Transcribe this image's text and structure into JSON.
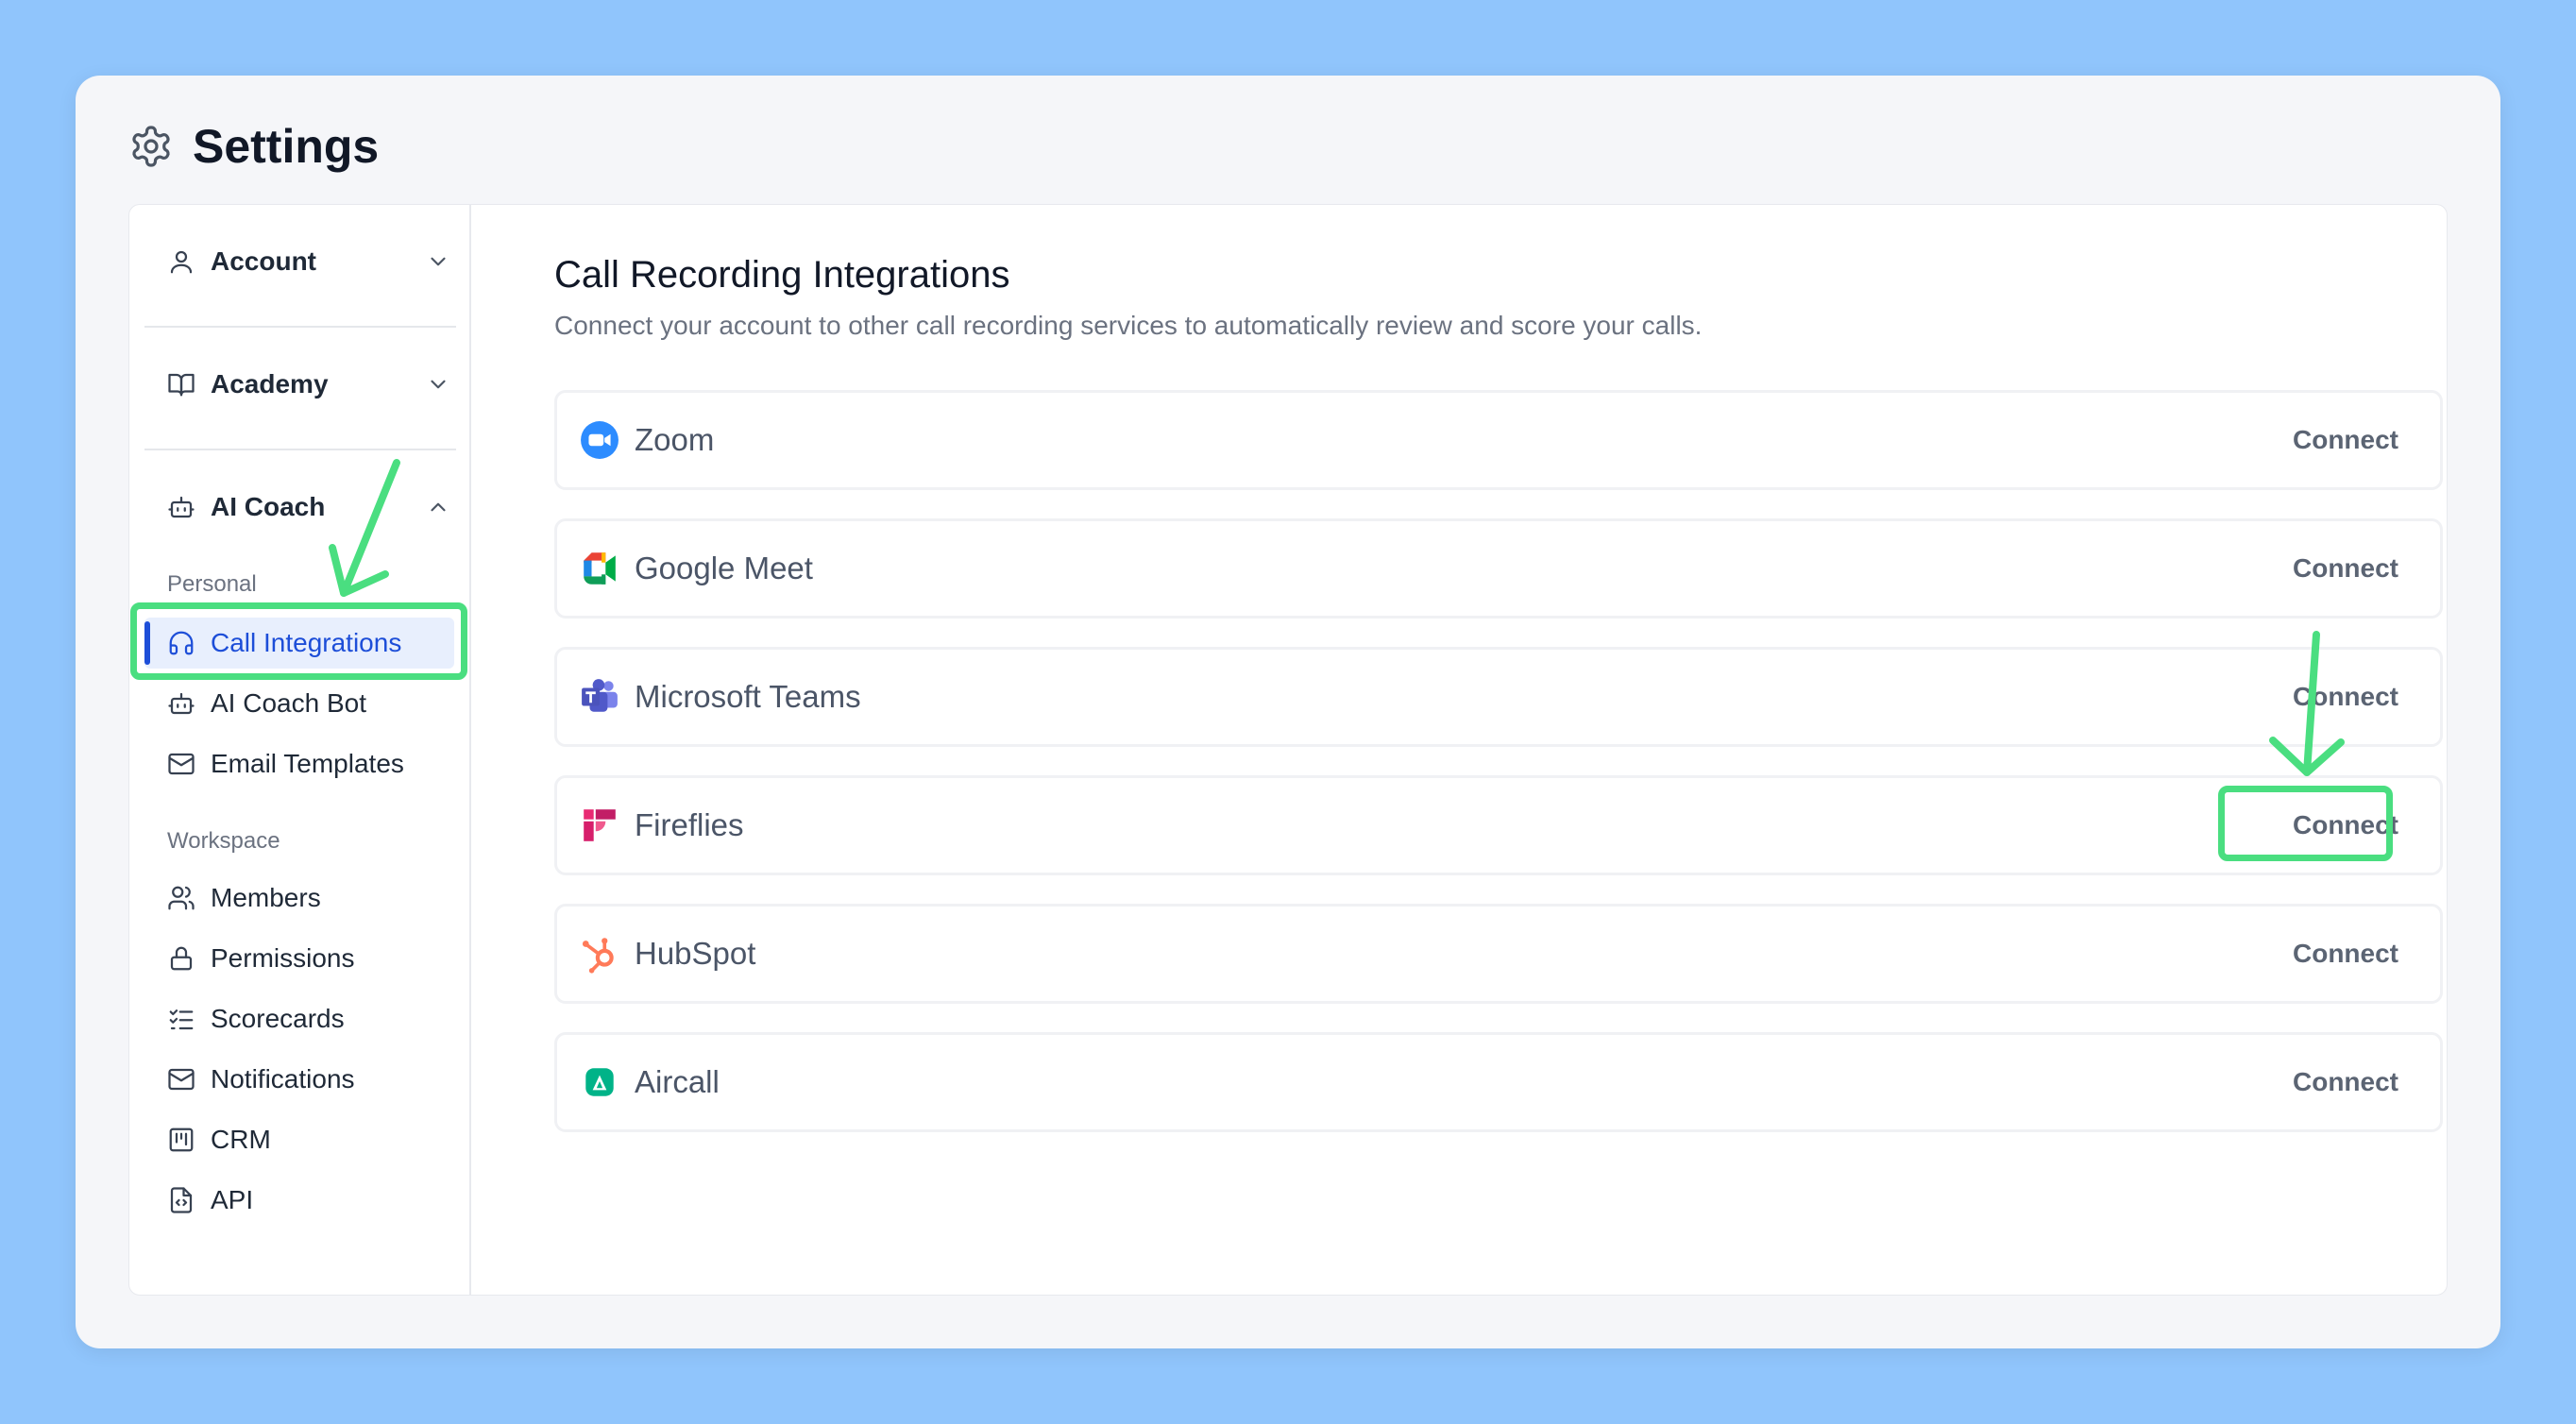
{
  "page": {
    "title": "Settings",
    "icon": "gear-icon"
  },
  "sidebar": {
    "sections": [
      {
        "label": "Account",
        "icon": "user-icon",
        "expanded": false
      },
      {
        "label": "Academy",
        "icon": "book-icon",
        "expanded": false
      },
      {
        "label": "AI Coach",
        "icon": "bot-icon",
        "expanded": true
      }
    ],
    "groups": {
      "personal": "Personal",
      "workspace": "Workspace"
    },
    "personal_items": [
      {
        "label": "Call Integrations",
        "icon": "headset-icon",
        "active": true
      },
      {
        "label": "AI Coach Bot",
        "icon": "bot-icon"
      },
      {
        "label": "Email Templates",
        "icon": "mail-icon"
      }
    ],
    "workspace_items": [
      {
        "label": "Members",
        "icon": "users-icon"
      },
      {
        "label": "Permissions",
        "icon": "lock-icon"
      },
      {
        "label": "Scorecards",
        "icon": "checklist-icon"
      },
      {
        "label": "Notifications",
        "icon": "mail-icon"
      },
      {
        "label": "CRM",
        "icon": "kanban-icon"
      },
      {
        "label": "API",
        "icon": "file-code-icon"
      }
    ]
  },
  "main": {
    "title": "Call Recording Integrations",
    "description": "Connect your account to other call recording services to automatically review and score your calls.",
    "integrations": [
      {
        "name": "Zoom",
        "icon": "zoom-logo-icon",
        "action": "Connect"
      },
      {
        "name": "Google Meet",
        "icon": "google-meet-logo-icon",
        "action": "Connect"
      },
      {
        "name": "Microsoft Teams",
        "icon": "microsoft-teams-logo-icon",
        "action": "Connect"
      },
      {
        "name": "Fireflies",
        "icon": "fireflies-logo-icon",
        "action": "Connect"
      },
      {
        "name": "HubSpot",
        "icon": "hubspot-logo-icon",
        "action": "Connect"
      },
      {
        "name": "Aircall",
        "icon": "aircall-logo-icon",
        "action": "Connect"
      }
    ]
  },
  "annotations": {
    "highlight_color": "#4ade80"
  },
  "colors": {
    "accent": "#1d4ed8",
    "background": "#90c5fc"
  }
}
